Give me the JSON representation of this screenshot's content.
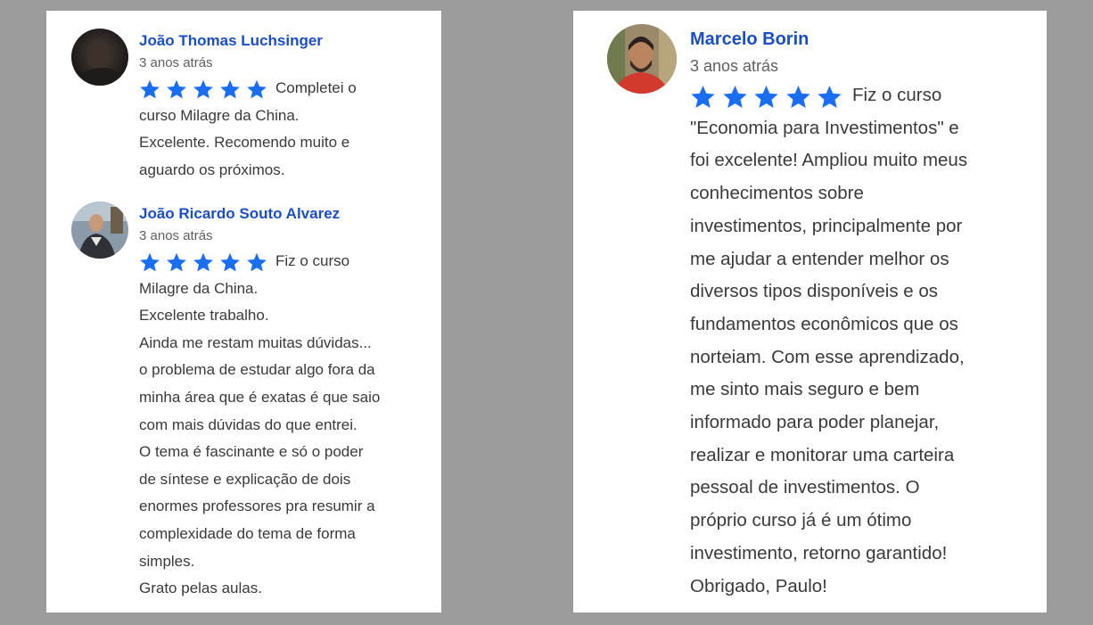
{
  "reviews_left": [
    {
      "author": "João Thomas Luchsinger",
      "date": "3 anos atrás",
      "rating": 5,
      "text": "Completei o\ncurso Milagre da China.\nExcelente. Recomendo muito e\naguardo os próximos."
    },
    {
      "author": "João Ricardo Souto Alvarez",
      "date": "3 anos atrás",
      "rating": 5,
      "text": "Fiz o curso\nMilagre da China.\nExcelente trabalho.\nAinda me restam muitas dúvidas...\no problema de estudar algo fora da\nminha área que é exatas é que saio\ncom mais dúvidas do que entrei.\nO tema é fascinante e só o poder\nde síntese e explicação de dois\nenormes professores pra resumir a\ncomplexidade do tema de forma\nsimples.\nGrato pelas aulas."
    }
  ],
  "reviews_right": [
    {
      "author": "Marcelo Borin",
      "date": "3 anos atrás",
      "rating": 5,
      "text": "Fiz o curso\n\"Economia para Investimentos\" e\nfoi excelente! Ampliou muito meus\nconhecimentos sobre\ninvestimentos, principalmente por\nme ajudar a entender  melhor os\ndiversos tipos disponíveis e os\nfundamentos econômicos que os\nnorteiam. Com esse aprendizado,\nme sinto mais seguro e bem\ninformado para poder planejar,\nrealizar e monitorar uma carteira\npessoal de investimentos. O\npróprio curso já é um ótimo\ninvestimento, retorno garantido!\nObrigado, Paulo!"
    }
  ],
  "colors": {
    "star": "#1a6ef5",
    "author": "#1a4fc4",
    "background": "#9b9b9b"
  },
  "icons": {
    "star": "star-icon"
  }
}
